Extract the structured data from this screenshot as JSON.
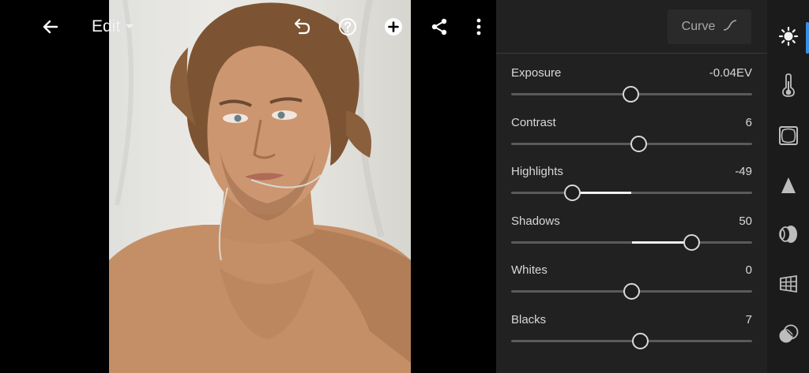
{
  "topbar": {
    "mode_label": "Edit",
    "icons": [
      "back-arrow-icon",
      "chevron-down-icon",
      "undo-icon",
      "help-icon",
      "add-icon",
      "share-icon",
      "more-vert-icon"
    ]
  },
  "panel": {
    "curve_label": "Curve",
    "sliders": [
      {
        "label": "Exposure",
        "value": "-0.04EV",
        "min": -5,
        "max": 5,
        "num": -0.04
      },
      {
        "label": "Contrast",
        "value": "6",
        "min": -100,
        "max": 100,
        "num": 6
      },
      {
        "label": "Highlights",
        "value": "-49",
        "min": -100,
        "max": 100,
        "num": -49
      },
      {
        "label": "Shadows",
        "value": "50",
        "min": -100,
        "max": 100,
        "num": 50
      },
      {
        "label": "Whites",
        "value": "0",
        "min": -100,
        "max": 100,
        "num": 0
      },
      {
        "label": "Blacks",
        "value": "7",
        "min": -100,
        "max": 100,
        "num": 7
      }
    ]
  },
  "tools": [
    {
      "name": "light-icon",
      "active": true
    },
    {
      "name": "color-temperature-icon",
      "active": false
    },
    {
      "name": "effects-icon",
      "active": false
    },
    {
      "name": "detail-icon",
      "active": false
    },
    {
      "name": "optics-icon",
      "active": false
    },
    {
      "name": "geometry-icon",
      "active": false
    },
    {
      "name": "masking-icon",
      "active": false
    }
  ],
  "colors": {
    "accent": "#3a8ee6",
    "panel": "#212121",
    "rail": "#1b1b1b"
  }
}
